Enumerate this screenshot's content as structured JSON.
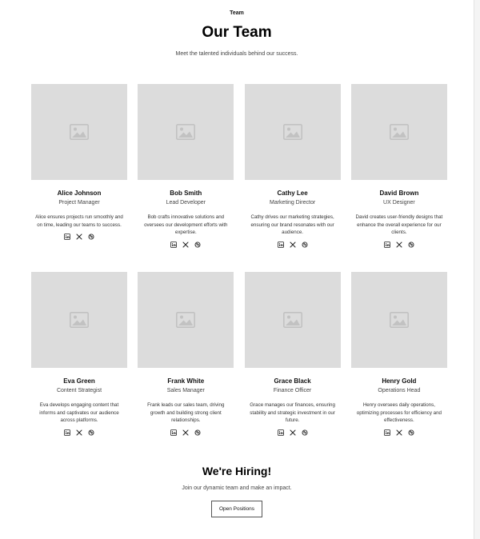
{
  "header": {
    "eyebrow": "Team",
    "title": "Our Team",
    "subtitle": "Meet the talented individuals behind our success."
  },
  "team": [
    {
      "name": "Alice Johnson",
      "role": "Project Manager",
      "bio": "Alice ensures projects run smoothly and on time, leading our teams to success."
    },
    {
      "name": "Bob Smith",
      "role": "Lead Developer",
      "bio": "Bob crafts innovative solutions and oversees our development efforts with expertise."
    },
    {
      "name": "Cathy Lee",
      "role": "Marketing Director",
      "bio": "Cathy drives our marketing strategies, ensuring our brand resonates with our audience."
    },
    {
      "name": "David Brown",
      "role": "UX Designer",
      "bio": "David creates user-friendly designs that enhance the overall experience for our clients."
    },
    {
      "name": "Eva Green",
      "role": "Content Strategist",
      "bio": "Eva develops engaging content that informs and captivates our audience across platforms."
    },
    {
      "name": "Frank White",
      "role": "Sales Manager",
      "bio": "Frank leads our sales team, driving growth and building strong client relationships."
    },
    {
      "name": "Grace Black",
      "role": "Finance Officer",
      "bio": "Grace manages our finances, ensuring stability and strategic investment in our future."
    },
    {
      "name": "Henry Gold",
      "role": "Operations Head",
      "bio": "Henry oversees daily operations, optimizing processes for efficiency and effectiveness."
    }
  ],
  "social_icons": [
    "linkedin-icon",
    "x-icon",
    "dribbble-icon"
  ],
  "hiring": {
    "title": "We're Hiring!",
    "subtitle": "Join our dynamic team and make an impact.",
    "button_label": "Open Positions"
  },
  "colors": {
    "placeholder_bg": "#dcdcdc",
    "placeholder_icon": "#c2c2c2",
    "text": "#111111",
    "muted": "#444444"
  }
}
